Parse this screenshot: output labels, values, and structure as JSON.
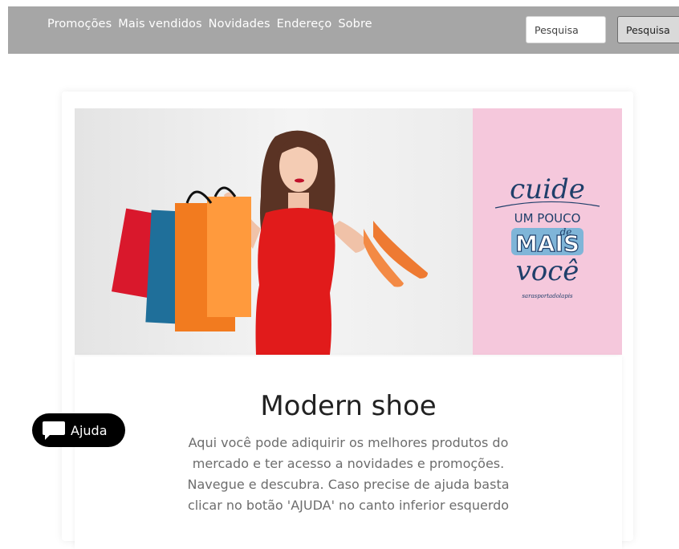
{
  "nav": {
    "links": [
      "Promoções",
      "Mais vendidos",
      "Novidades",
      "Endereço",
      "Sobre"
    ],
    "search_placeholder": "Pesquisa",
    "search_button": "Pesquisa"
  },
  "banner": {
    "art_lines": [
      "cuide",
      "UM POUCO",
      "de",
      "MAIS",
      "você"
    ],
    "signature": "sarasportadolapis"
  },
  "main": {
    "title": "Modern shoe",
    "description": "Aqui você pode adiquirir os melhores produtos do mercado e ter acesso a novidades e promoções. Navegue e descubra. Caso precise de ajuda basta clicar no botão 'AJUDA' no canto inferior esquerdo"
  },
  "help": {
    "label": "Ajuda"
  },
  "colors": {
    "navbar": "#a6a6a6",
    "banner_pink": "#f5c8dc",
    "dress_red": "#e11b1b",
    "help_black": "#000000"
  },
  "icons": {
    "help": "chat-bubble-icon"
  }
}
